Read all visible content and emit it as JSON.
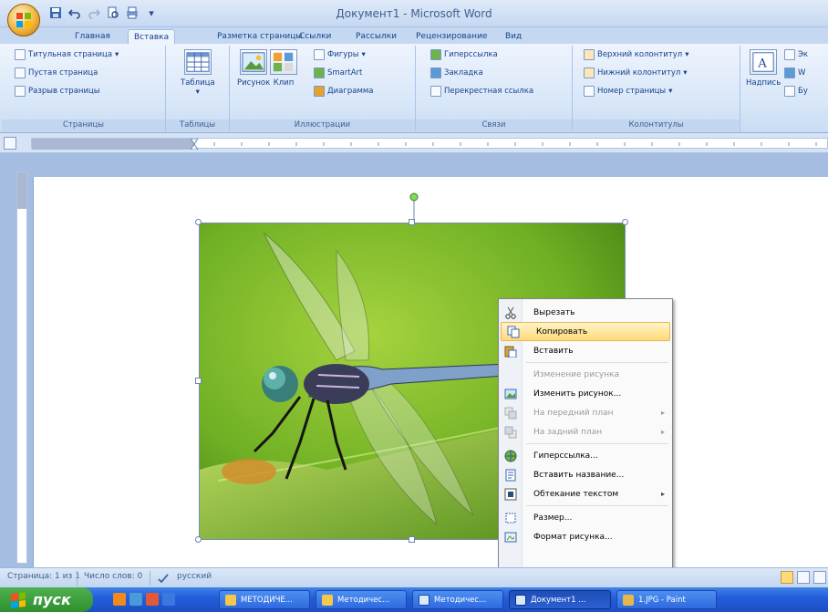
{
  "window": {
    "title": "Документ1 - Microsoft Word"
  },
  "quick_access": {
    "icons": [
      "save-icon",
      "undo-icon",
      "redo-icon",
      "print-preview-icon",
      "print-icon",
      "customize-icon"
    ],
    "customize_glyph": "▾"
  },
  "tabs": [
    {
      "label": "Главная",
      "active": false
    },
    {
      "label": "Вставка",
      "active": true
    },
    {
      "label": "Разметка страницы",
      "active": false
    },
    {
      "label": "Ссылки",
      "active": false
    },
    {
      "label": "Рассылки",
      "active": false
    },
    {
      "label": "Рецензирование",
      "active": false
    },
    {
      "label": "Вид",
      "active": false
    }
  ],
  "ribbon": {
    "pages": {
      "label": "Страницы",
      "items": [
        "Титульная страница",
        "Пустая страница",
        "Разрыв страницы"
      ]
    },
    "tables": {
      "label": "Таблицы",
      "table_button": "Таблица"
    },
    "illustrations": {
      "label": "Иллюстрации",
      "picture_button": "Рисунок",
      "clip_button": "Клип",
      "items": [
        "Фигуры",
        "SmartArt",
        "Диаграмма"
      ]
    },
    "links": {
      "label": "Связи",
      "items": [
        "Гиперссылка",
        "Закладка",
        "Перекрестная ссылка"
      ]
    },
    "header_footer": {
      "label": "Колонтитулы",
      "items": [
        "Верхний колонтитул",
        "Нижний колонтитул",
        "Номер страницы"
      ]
    },
    "text": {
      "text_box_button": "Надпись",
      "items": [
        "Эк",
        "W",
        "Бу"
      ]
    }
  },
  "context_menu": {
    "items": [
      {
        "label": "Вырезать",
        "icon": "scissors-icon",
        "disabled": false,
        "highlight": false,
        "submenu": false
      },
      {
        "label": "Копировать",
        "icon": "copy-icon",
        "disabled": false,
        "highlight": true,
        "submenu": false
      },
      {
        "label": "Вставить",
        "icon": "paste-icon",
        "disabled": false,
        "highlight": false,
        "submenu": false
      },
      {
        "label": "Изменение рисунка",
        "icon": "",
        "disabled": true,
        "highlight": false,
        "submenu": false
      },
      {
        "label": "Изменить рисунок...",
        "icon": "change-picture-icon",
        "disabled": false,
        "highlight": false,
        "submenu": false
      },
      {
        "label": "На передний план",
        "icon": "bring-front-icon",
        "disabled": true,
        "highlight": false,
        "submenu": true
      },
      {
        "label": "На задний план",
        "icon": "send-back-icon",
        "disabled": true,
        "highlight": false,
        "submenu": true
      },
      {
        "label": "Гиперссылка...",
        "icon": "hyperlink-icon",
        "disabled": false,
        "highlight": false,
        "submenu": false
      },
      {
        "label": "Вставить название...",
        "icon": "caption-icon",
        "disabled": false,
        "highlight": false,
        "submenu": false
      },
      {
        "label": "Обтекание текстом",
        "icon": "text-wrap-icon",
        "disabled": false,
        "highlight": false,
        "submenu": true
      },
      {
        "label": "Размер...",
        "icon": "size-icon",
        "disabled": false,
        "highlight": false,
        "submenu": false
      },
      {
        "label": "Формат рисунка...",
        "icon": "format-picture-icon",
        "disabled": false,
        "highlight": false,
        "submenu": false
      }
    ],
    "arrow": "▸"
  },
  "statusbar": {
    "page": "Страница: 1 из 1",
    "words": "Число слов: 0",
    "language": "русский"
  },
  "taskbar": {
    "start_label": "пуск",
    "buttons": [
      {
        "label": "МЕТОДИЧЕ...",
        "icon": "folder-icon",
        "active": false
      },
      {
        "label": "Методичес...",
        "icon": "folder-icon",
        "active": false
      },
      {
        "label": "Методичес...",
        "icon": "word-icon",
        "active": false
      },
      {
        "label": "Документ1 ...",
        "icon": "word-icon",
        "active": true
      },
      {
        "label": "1.JPG - Paint",
        "icon": "paint-icon",
        "active": false
      }
    ]
  },
  "colors": {
    "ribbon_text": "#15428b",
    "menu_highlight": "#ffd97a",
    "taskbar_blue": "#245edb",
    "start_green": "#3a9a3a"
  }
}
